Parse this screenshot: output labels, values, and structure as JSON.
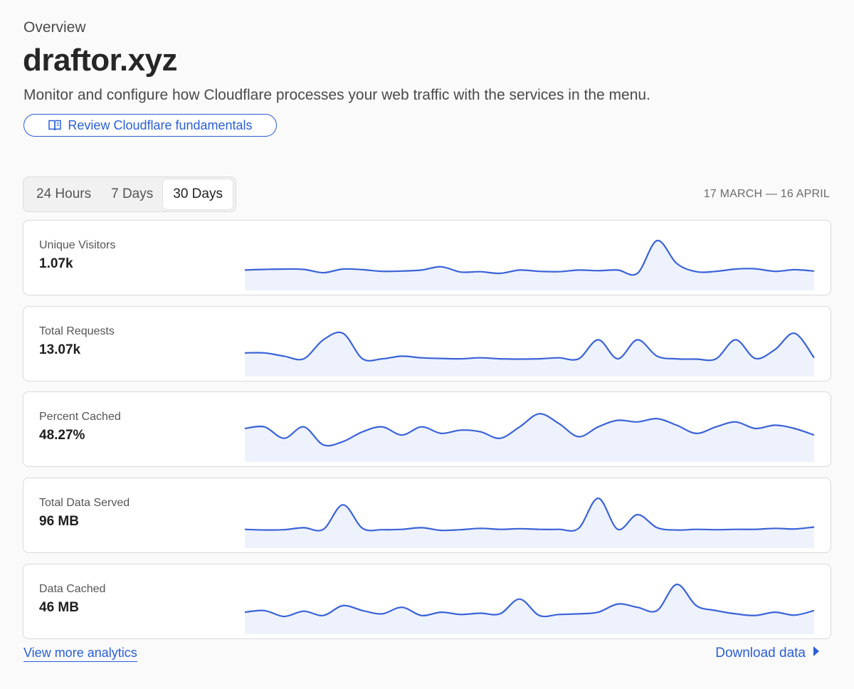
{
  "header": {
    "eyebrow": "Overview",
    "title": "draftor.xyz",
    "description": "Monitor and configure how Cloudflare processes your web traffic with the services in the menu.",
    "fundamentals_button": "Review Cloudflare fundamentals"
  },
  "tabs": [
    {
      "label": "24 Hours",
      "active": false
    },
    {
      "label": "7 Days",
      "active": false
    },
    {
      "label": "30 Days",
      "active": true
    }
  ],
  "date_range": "17 MARCH — 16 APRIL",
  "metrics": [
    {
      "label": "Unique Visitors",
      "value": "1.07k"
    },
    {
      "label": "Total Requests",
      "value": "13.07k"
    },
    {
      "label": "Percent Cached",
      "value": "48.27%"
    },
    {
      "label": "Total Data Served",
      "value": "96 MB"
    },
    {
      "label": "Data Cached",
      "value": "46 MB"
    }
  ],
  "footer": {
    "view_more": "View more analytics",
    "download": "Download data"
  },
  "colors": {
    "accent": "#2a5fd6",
    "sparkline": "#3a63d8",
    "sparkline_fill": "#eef2fd"
  },
  "chart_data": [
    {
      "type": "area",
      "series": [
        {
          "values": [
            0.1,
            0.12,
            0.13,
            0.12,
            0.02,
            0.13,
            0.11,
            0.06,
            0.07,
            0.1,
            0.2,
            0.04,
            0.05,
            0.0,
            0.1,
            0.06,
            0.05,
            0.1,
            0.08,
            0.1,
            0.0,
            1.0,
            0.3,
            0.05,
            0.06,
            0.13,
            0.14,
            0.06,
            0.11,
            0.07
          ]
        }
      ]
    },
    {
      "type": "area",
      "series": [
        {
          "values": [
            0.2,
            0.2,
            0.1,
            0.02,
            0.6,
            0.8,
            0.02,
            0.02,
            0.1,
            0.05,
            0.03,
            0.02,
            0.05,
            0.02,
            0.01,
            0.02,
            0.05,
            0.02,
            0.6,
            0.02,
            0.6,
            0.1,
            0.02,
            0.01,
            0.02,
            0.6,
            0.03,
            0.3,
            0.8,
            0.05
          ]
        }
      ]
    },
    {
      "type": "area",
      "series": [
        {
          "values": [
            0.5,
            0.55,
            0.2,
            0.55,
            0.0,
            0.1,
            0.4,
            0.55,
            0.3,
            0.55,
            0.35,
            0.45,
            0.4,
            0.2,
            0.55,
            0.95,
            0.65,
            0.25,
            0.55,
            0.75,
            0.7,
            0.8,
            0.6,
            0.35,
            0.55,
            0.7,
            0.5,
            0.6,
            0.5,
            0.3
          ]
        }
      ]
    },
    {
      "type": "area",
      "series": [
        {
          "values": [
            0.05,
            0.03,
            0.04,
            0.1,
            0.05,
            0.8,
            0.08,
            0.04,
            0.05,
            0.1,
            0.02,
            0.04,
            0.08,
            0.05,
            0.07,
            0.05,
            0.05,
            0.08,
            1.0,
            0.05,
            0.5,
            0.1,
            0.03,
            0.05,
            0.04,
            0.05,
            0.05,
            0.08,
            0.06,
            0.12
          ]
        }
      ]
    },
    {
      "type": "area",
      "series": [
        {
          "values": [
            0.15,
            0.2,
            0.02,
            0.18,
            0.05,
            0.35,
            0.2,
            0.1,
            0.3,
            0.05,
            0.15,
            0.08,
            0.12,
            0.1,
            0.55,
            0.05,
            0.08,
            0.1,
            0.15,
            0.4,
            0.3,
            0.2,
            1.0,
            0.35,
            0.2,
            0.1,
            0.05,
            0.15,
            0.06,
            0.2
          ]
        }
      ]
    }
  ]
}
